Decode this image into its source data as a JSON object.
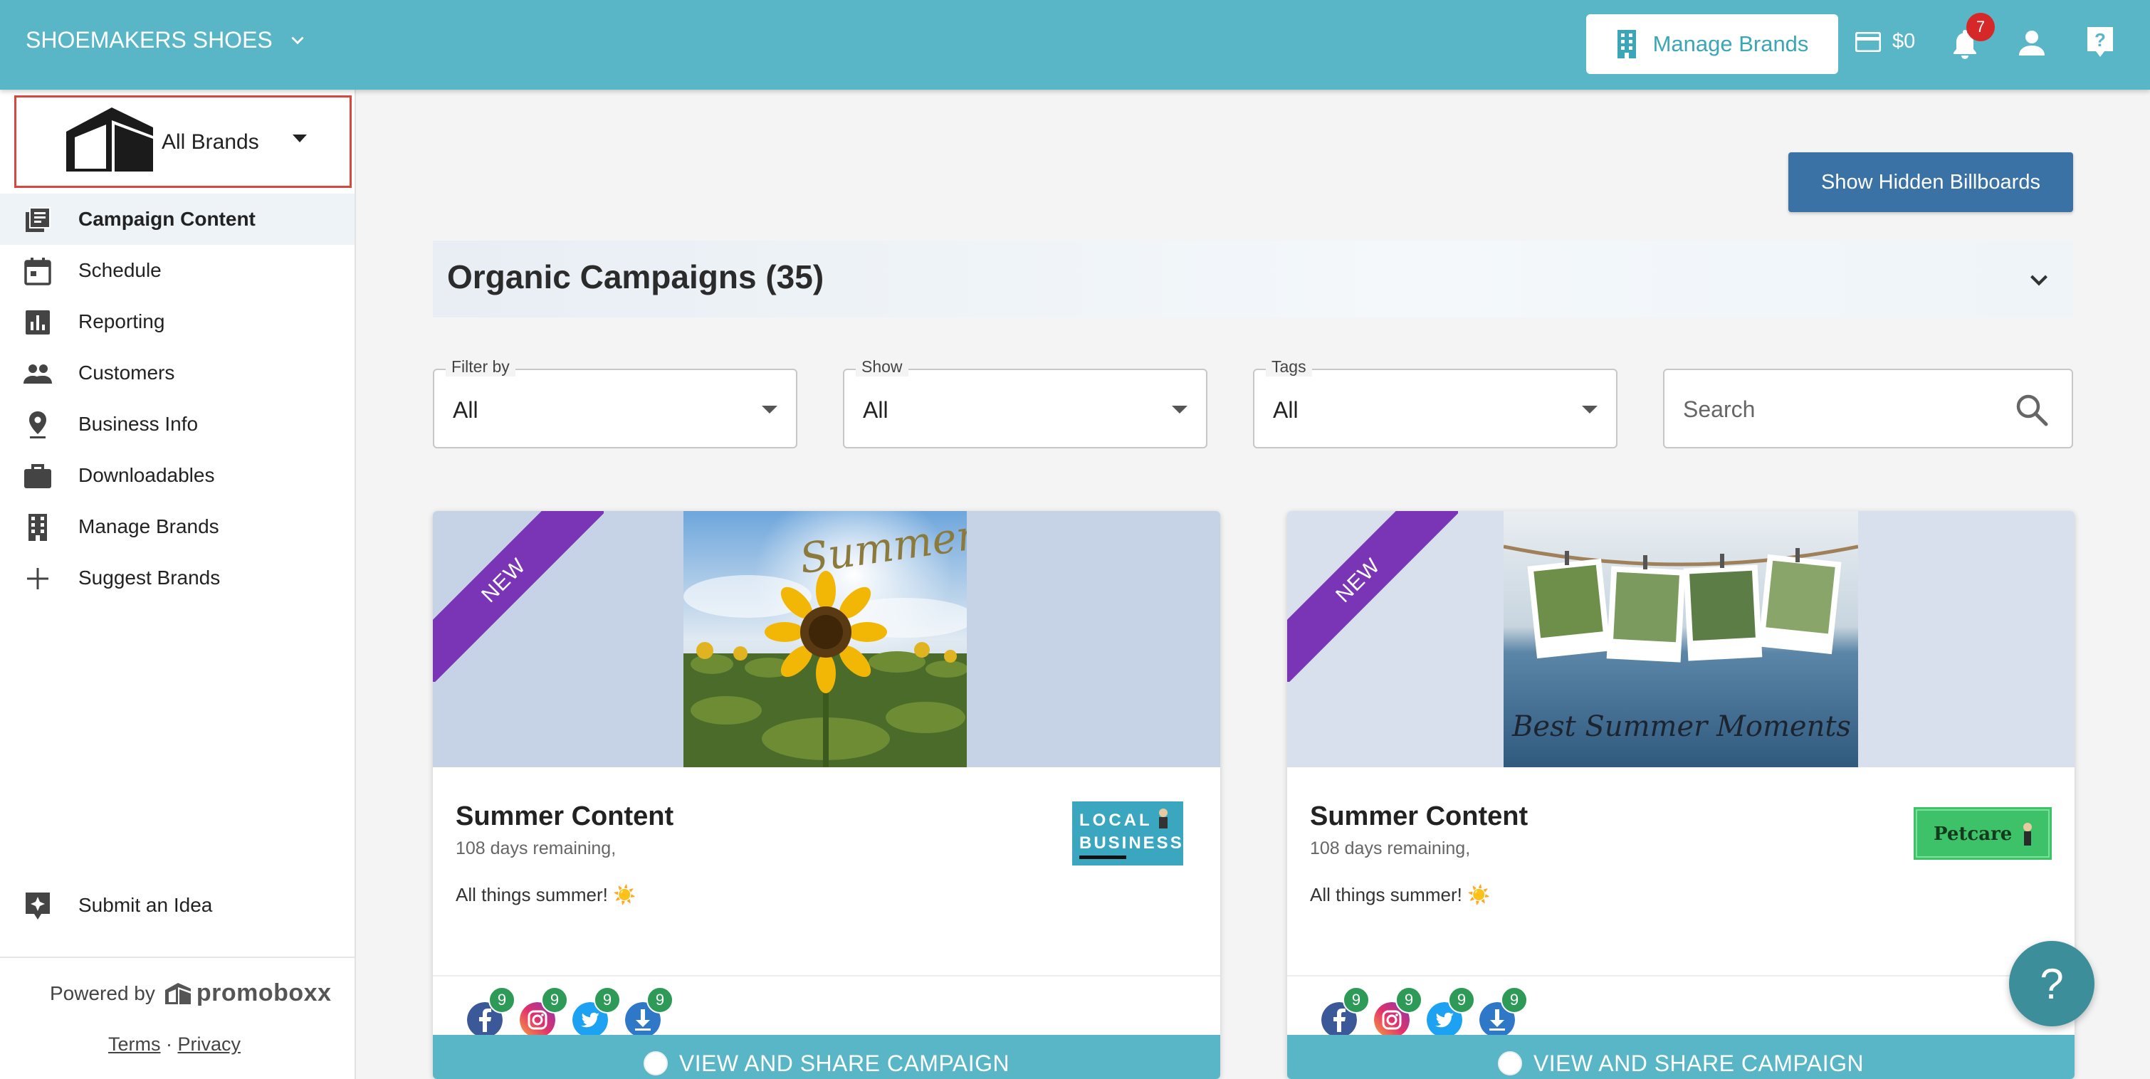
{
  "topbar": {
    "org_name": "SHOEMAKERS SHOES",
    "manage_brands_label": "Manage Brands",
    "credit_amount": "$0",
    "notification_count": "7"
  },
  "sidebar": {
    "brand_selector": "All Brands",
    "items": [
      {
        "label": "Campaign Content",
        "icon": "campaign-content-icon",
        "active": true
      },
      {
        "label": "Schedule",
        "icon": "calendar-icon",
        "active": false
      },
      {
        "label": "Reporting",
        "icon": "bar-chart-icon",
        "active": false
      },
      {
        "label": "Customers",
        "icon": "people-icon",
        "active": false
      },
      {
        "label": "Business Info",
        "icon": "location-pin-icon",
        "active": false
      },
      {
        "label": "Downloadables",
        "icon": "briefcase-icon",
        "active": false
      },
      {
        "label": "Manage Brands",
        "icon": "building-icon",
        "active": false
      },
      {
        "label": "Suggest Brands",
        "icon": "plus-icon",
        "active": false
      }
    ],
    "submit_idea": "Submit an Idea",
    "powered_by": "Powered by",
    "powered_brand": "promoboxx",
    "terms": "Terms",
    "separator": "·",
    "privacy": "Privacy"
  },
  "main": {
    "show_hidden_label": "Show Hidden Billboards",
    "section_title": "Organic Campaigns (35)",
    "filters": [
      {
        "label": "Filter by",
        "value": "All"
      },
      {
        "label": "Show",
        "value": "All"
      },
      {
        "label": "Tags",
        "value": "All"
      }
    ],
    "search_placeholder": "Search"
  },
  "cards": [
    {
      "ribbon": "NEW",
      "title": "Summer Content",
      "subtitle": "108 days remaining,",
      "description": "All things summer! ☀️",
      "hero_script": "Summer",
      "brand_tag": {
        "line1": "LOCAL",
        "line2": "BUSINESS"
      },
      "socials": [
        {
          "icon": "facebook-icon",
          "count": "9"
        },
        {
          "icon": "instagram-icon",
          "count": "9"
        },
        {
          "icon": "twitter-icon",
          "count": "9"
        },
        {
          "icon": "download-icon",
          "count": "9"
        }
      ],
      "cta": "VIEW AND SHARE CAMPAIGN"
    },
    {
      "ribbon": "NEW",
      "title": "Summer Content",
      "subtitle": "108 days remaining,",
      "description": "All things summer! ☀️",
      "hero_script": "Best Summer Moments",
      "brand_tag": {
        "line1": "Petcare"
      },
      "socials": [
        {
          "icon": "facebook-icon",
          "count": "9"
        },
        {
          "icon": "instagram-icon",
          "count": "9"
        },
        {
          "icon": "twitter-icon",
          "count": "9"
        },
        {
          "icon": "download-icon",
          "count": "9"
        }
      ],
      "cta": "VIEW AND SHARE CAMPAIGN"
    }
  ],
  "help_label": "?",
  "colors": {
    "topbar": "#58b6c6",
    "primary_button": "#3a72a6",
    "ribbon": "#7a35b6",
    "count_badge": "#2e9a57",
    "notification_badge": "#d62828"
  }
}
